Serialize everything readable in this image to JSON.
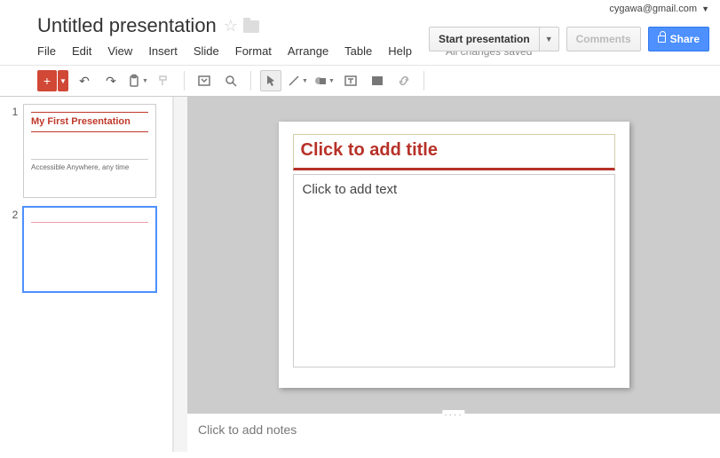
{
  "account": {
    "email": "cygawa@gmail.com"
  },
  "doc": {
    "title": "Untitled presentation"
  },
  "actions": {
    "start": "Start presentation",
    "comments": "Comments",
    "share": "Share"
  },
  "menu": {
    "file": "File",
    "edit": "Edit",
    "view": "View",
    "insert": "Insert",
    "slide": "Slide",
    "format": "Format",
    "arrange": "Arrange",
    "table": "Table",
    "help": "Help",
    "save_status": "All changes saved"
  },
  "thumbs": [
    {
      "num": "1",
      "title": "My First Presentation",
      "subtitle": "Accessible Anywhere, any time"
    },
    {
      "num": "2"
    }
  ],
  "canvas": {
    "title_placeholder": "Click to add title",
    "body_placeholder": "Click to add text"
  },
  "notes": {
    "placeholder": "Click to add notes"
  }
}
